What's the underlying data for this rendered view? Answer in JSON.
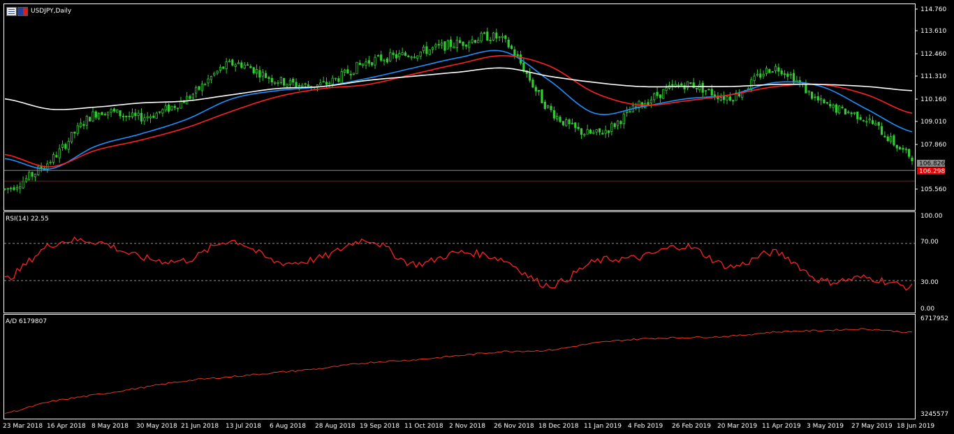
{
  "symbol_title": "USDJPY,Daily",
  "rsi_title": "RSI(14) 22.55",
  "ad_title": "A/D 6179807",
  "colors": {
    "background": "#000000",
    "candle": "#32cd32",
    "ma_fast": "#1e90ff",
    "ma_mid": "#ff2020",
    "ma_slow": "#ffffff",
    "rsi_line": "#ff2020",
    "ad_line": "#ff3b1f",
    "bid_line": "#a0a0a0",
    "ask_line": "#ff0000",
    "grid_axis": "#ffffff"
  },
  "icons": [
    "chart-window-icon",
    "flag-icon"
  ],
  "price_axis": [
    "114.760",
    "113.610",
    "112.460",
    "111.310",
    "110.160",
    "109.010",
    "107.860",
    "105.560"
  ],
  "price_badges": {
    "bid": "106.826",
    "ask": "106.298"
  },
  "rsi_axis": [
    "100.00",
    "70.00",
    "30.00",
    "0.00"
  ],
  "ad_axis": {
    "max": "6717952",
    "min": "3245577"
  },
  "date_axis": [
    "23 Mar 2018",
    "16 Apr 2018",
    "8 May 2018",
    "30 May 2018",
    "21 Jun 2018",
    "13 Jul 2018",
    "6 Aug 2018",
    "28 Aug 2018",
    "19 Sep 2018",
    "11 Oct 2018",
    "2 Nov 2018",
    "26 Nov 2018",
    "18 Dec 2018",
    "11 Jan 2019",
    "4 Feb 2019",
    "26 Feb 2019",
    "20 Mar 2019",
    "11 Apr 2019",
    "3 May 2019",
    "27 May 2019",
    "18 Jun 2019"
  ],
  "chart_data": [
    {
      "type": "candlestick",
      "title": "USDJPY,Daily",
      "ylim": [
        104.9,
        114.9
      ],
      "x": [
        "23 Mar 2018",
        "16 Apr 2018",
        "8 May 2018",
        "30 May 2018",
        "21 Jun 2018",
        "13 Jul 2018",
        "6 Aug 2018",
        "28 Aug 2018",
        "19 Sep 2018",
        "11 Oct 2018",
        "2 Nov 2018",
        "26 Nov 2018",
        "18 Dec 2018",
        "11 Jan 2019",
        "4 Feb 2019",
        "26 Feb 2019",
        "20 Mar 2019",
        "11 Apr 2019",
        "3 May 2019",
        "27 May 2019",
        "18 Jun 2019"
      ],
      "series": [
        {
          "values": [
            105.9,
            107.3,
            109.6,
            109.4,
            110.3,
            112.0,
            111.2,
            111.0,
            112.1,
            112.5,
            113.0,
            113.1,
            109.8,
            108.6,
            110.0,
            111.0,
            110.4,
            111.8,
            110.1,
            109.3,
            107.5
          ]
        },
        {
          "values": [
            107.4,
            106.9,
            108.0,
            108.6,
            109.3,
            110.3,
            110.7,
            110.9,
            111.3,
            111.8,
            112.3,
            112.6,
            111.2,
            109.6,
            109.9,
            110.3,
            110.5,
            111.1,
            110.9,
            109.8,
            108.7
          ]
        },
        {
          "values": [
            107.6,
            107.0,
            107.8,
            108.3,
            108.9,
            109.7,
            110.4,
            110.8,
            111.0,
            111.5,
            112.0,
            112.4,
            111.9,
            110.6,
            110.0,
            110.2,
            110.5,
            110.9,
            111.0,
            110.5,
            109.6
          ]
        },
        {
          "values": [
            110.3,
            109.8,
            109.9,
            110.1,
            110.2,
            110.5,
            110.8,
            110.9,
            111.2,
            111.4,
            111.6,
            111.8,
            111.4,
            111.1,
            110.9,
            110.9,
            110.9,
            111.0,
            111.0,
            110.9,
            110.7
          ]
        }
      ],
      "bid": 106.826,
      "ask": 106.298
    },
    {
      "type": "line",
      "title": "RSI(14) 22.55",
      "ylim": [
        0,
        100
      ],
      "levels": [
        70,
        30
      ],
      "x": [
        "23 Mar 2018",
        "16 Apr 2018",
        "8 May 2018",
        "30 May 2018",
        "21 Jun 2018",
        "13 Jul 2018",
        "6 Aug 2018",
        "28 Aug 2018",
        "19 Sep 2018",
        "11 Oct 2018",
        "2 Nov 2018",
        "26 Nov 2018",
        "18 Dec 2018",
        "11 Jan 2019",
        "4 Feb 2019",
        "26 Feb 2019",
        "20 Mar 2019",
        "11 Apr 2019",
        "3 May 2019",
        "27 May 2019",
        "18 Jun 2019"
      ],
      "values": [
        31,
        68,
        72,
        55,
        52,
        73,
        50,
        55,
        74,
        48,
        60,
        52,
        25,
        50,
        55,
        67,
        45,
        60,
        30,
        33,
        22.55
      ]
    },
    {
      "type": "line",
      "title": "A/D 6179807",
      "ylim": [
        3245577,
        6717952
      ],
      "x": [
        "23 Mar 2018",
        "16 Apr 2018",
        "8 May 2018",
        "30 May 2018",
        "21 Jun 2018",
        "13 Jul 2018",
        "6 Aug 2018",
        "28 Aug 2018",
        "19 Sep 2018",
        "11 Oct 2018",
        "2 Nov 2018",
        "26 Nov 2018",
        "18 Dec 2018",
        "11 Jan 2019",
        "4 Feb 2019",
        "26 Feb 2019",
        "20 Mar 2019",
        "11 Apr 2019",
        "3 May 2019",
        "27 May 2019",
        "18 Jun 2019"
      ],
      "values": [
        3300000,
        3700000,
        3950000,
        4200000,
        4450000,
        4600000,
        4750000,
        4900000,
        5100000,
        5200000,
        5350000,
        5500000,
        5550000,
        5800000,
        5950000,
        6000000,
        6050000,
        6200000,
        6250000,
        6300000,
        6179807
      ]
    }
  ]
}
